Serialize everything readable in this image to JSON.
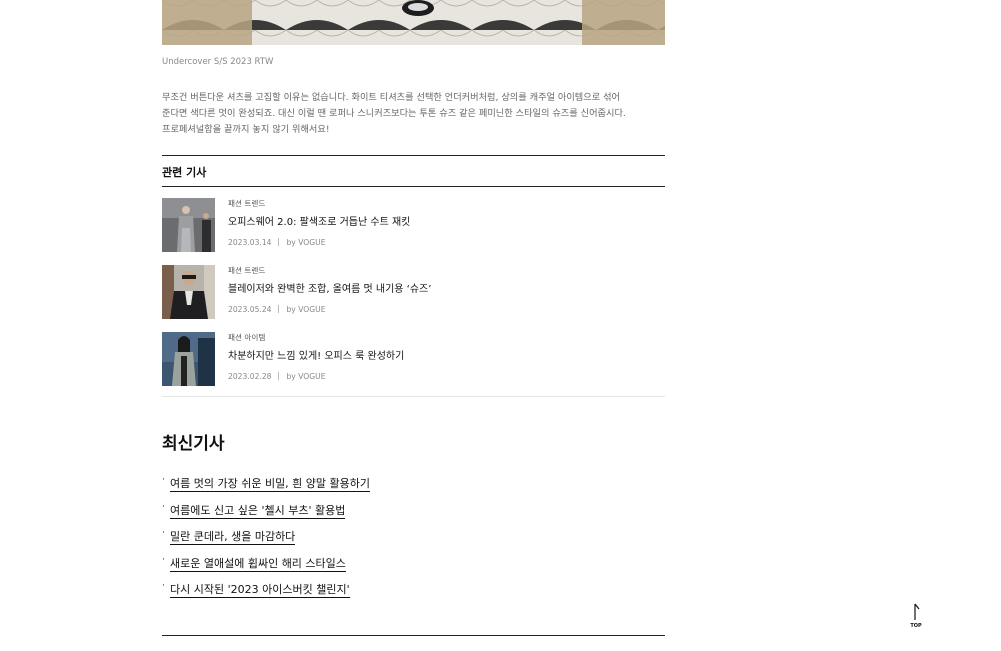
{
  "hero": {
    "caption": "Undercover S/S 2023 RTW"
  },
  "body": {
    "paragraph_lines": [
      "무조건 버튼다운 셔츠를 고집할 이유는 없습니다. 화이트 티셔츠를 선택한 언더커버처럼, 상의를 캐주얼 아이템으로 섞어",
      "준다면 색다른 멋이 완성되죠. 대신 이럴 땐 로퍼나 스니커즈보다는 투톤 슈즈 같은 페미닌한 스타일의 슈즈를 신어줍시다.",
      "프로페셔널함을 끝까지 놓지 않기 위해서요!"
    ]
  },
  "related": {
    "title": "관련 기사",
    "articles": [
      {
        "category": "패션 트렌드",
        "title": "오피스웨어 2.0: 팔색조로 거듭난 수트 재킷",
        "date": "2023.03.14",
        "byline": "by VOGUE"
      },
      {
        "category": "패션 트렌드",
        "title": "블레이저와 완벽한 조합, 올여름 멋 내기용 ‘슈즈’",
        "date": "2023.05.24",
        "byline": "by VOGUE"
      },
      {
        "category": "패션 아이템",
        "title": "차분하지만 느낌 있게! 오피스 룩 완성하기",
        "date": "2023.02.28",
        "byline": "by VOGUE"
      }
    ]
  },
  "latest": {
    "title": "최신기사",
    "items": [
      "여름 멋의 가장 쉬운 비밀, 흰 양말 활용하기",
      "여름에도 신고 싶은 '첼시 부츠' 활용법",
      "밀란 쿤데라, 생을 마감하다",
      "새로운 열애설에 휩싸인 해리 스타일스",
      "다시 시작된 '2023 아이스버킷 챌린지'"
    ],
    "bullet": "·"
  },
  "top_button": {
    "label": "TOP",
    "icon": "arrow-up-icon"
  }
}
